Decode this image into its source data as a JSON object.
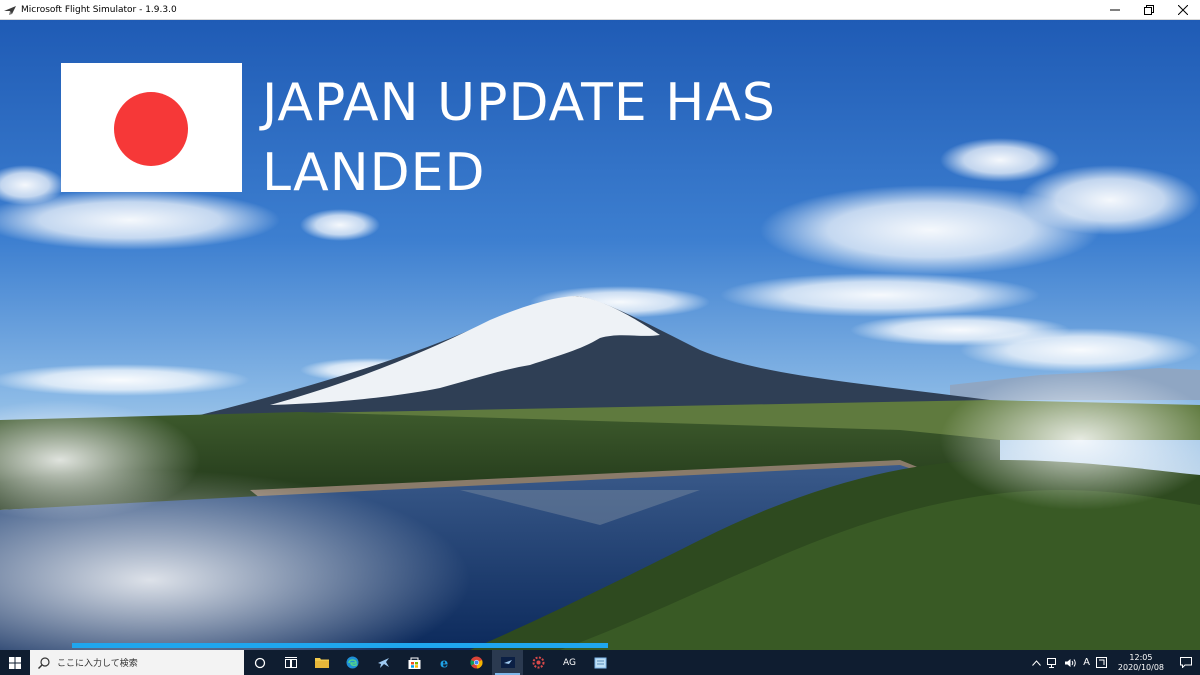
{
  "window": {
    "title": "Microsoft Flight Simulator - 1.9.3.0"
  },
  "loading": {
    "headline_line1": "JAPAN UPDATE HAS",
    "headline_line2": "LANDED",
    "progress_fraction": 0.51
  },
  "taskbar": {
    "search_placeholder": "ここに入力して検索",
    "apps": [
      {
        "name": "cortana-icon"
      },
      {
        "name": "task-view-icon"
      },
      {
        "name": "file-explorer-icon"
      },
      {
        "name": "edge-icon"
      },
      {
        "name": "flight-app-icon"
      },
      {
        "name": "store-icon"
      },
      {
        "name": "internet-explorer-icon"
      },
      {
        "name": "chrome-icon"
      },
      {
        "name": "flight-simulator-icon"
      },
      {
        "name": "settings-gear-app-icon"
      },
      {
        "name": "ag-app-icon"
      },
      {
        "name": "notepad-app-icon"
      }
    ],
    "ag_label": "AG",
    "ime_label": "A",
    "clock_time": "12:05",
    "clock_date": "2020/10/08"
  },
  "colors": {
    "flag_red": "#f63838",
    "progress": "#1fa6ee",
    "taskbar": "#0f1d30"
  }
}
